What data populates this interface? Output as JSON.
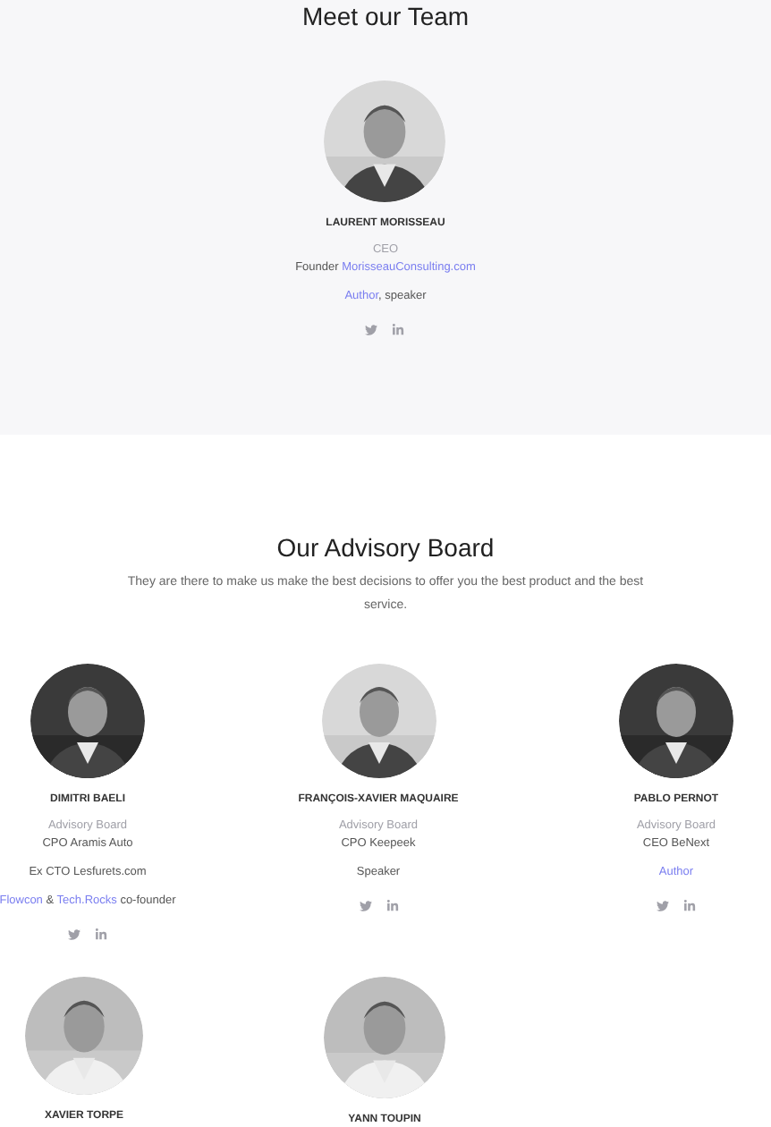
{
  "team": {
    "title": "Meet our Team",
    "members": [
      {
        "name": "LAURENT MORISSEAU",
        "social": true,
        "blocks": [
          [
            [
              {
                "kind": "role",
                "text": "CEO"
              }
            ],
            [
              {
                "kind": "text",
                "text": "Founder "
              },
              {
                "kind": "link",
                "text": "MorisseauConsulting.com"
              }
            ]
          ],
          [
            [
              {
                "kind": "link",
                "text": "Author"
              },
              {
                "kind": "text",
                "text": ", speaker"
              }
            ]
          ]
        ]
      }
    ]
  },
  "advisory": {
    "title": "Our Advisory Board",
    "description": "They are there to make us make the best decisions to offer you the best product and the best service.",
    "members": [
      {
        "name": "DIMITRI BAELI",
        "social": true,
        "blocks": [
          [
            [
              {
                "kind": "role",
                "text": "Advisory Board"
              }
            ],
            [
              {
                "kind": "text",
                "text": "CPO Aramis Auto"
              }
            ]
          ],
          [
            [
              {
                "kind": "text",
                "text": "Ex CTO Lesfurets.com"
              }
            ]
          ],
          [
            [
              {
                "kind": "link",
                "text": "Flowcon"
              },
              {
                "kind": "text",
                "text": " & "
              },
              {
                "kind": "link",
                "text": "Tech.Rocks"
              },
              {
                "kind": "text",
                "text": " co-founder"
              }
            ]
          ]
        ]
      },
      {
        "name": "FRANÇOIS-XAVIER MAQUAIRE",
        "social": true,
        "blocks": [
          [
            [
              {
                "kind": "role",
                "text": "Advisory Board"
              }
            ],
            [
              {
                "kind": "text",
                "text": "CPO Keepeek"
              }
            ]
          ],
          [
            [
              {
                "kind": "text",
                "text": "Speaker"
              }
            ]
          ]
        ]
      },
      {
        "name": "PABLO PERNOT",
        "social": true,
        "blocks": [
          [
            [
              {
                "kind": "role",
                "text": "Advisory Board"
              }
            ],
            [
              {
                "kind": "text",
                "text": "CEO BeNext"
              }
            ]
          ],
          [
            [
              {
                "kind": "link",
                "text": "Author"
              }
            ]
          ]
        ]
      },
      {
        "name": "XAVIER TORPE"
      },
      {
        "name": "YANN TOUPIN"
      }
    ]
  }
}
